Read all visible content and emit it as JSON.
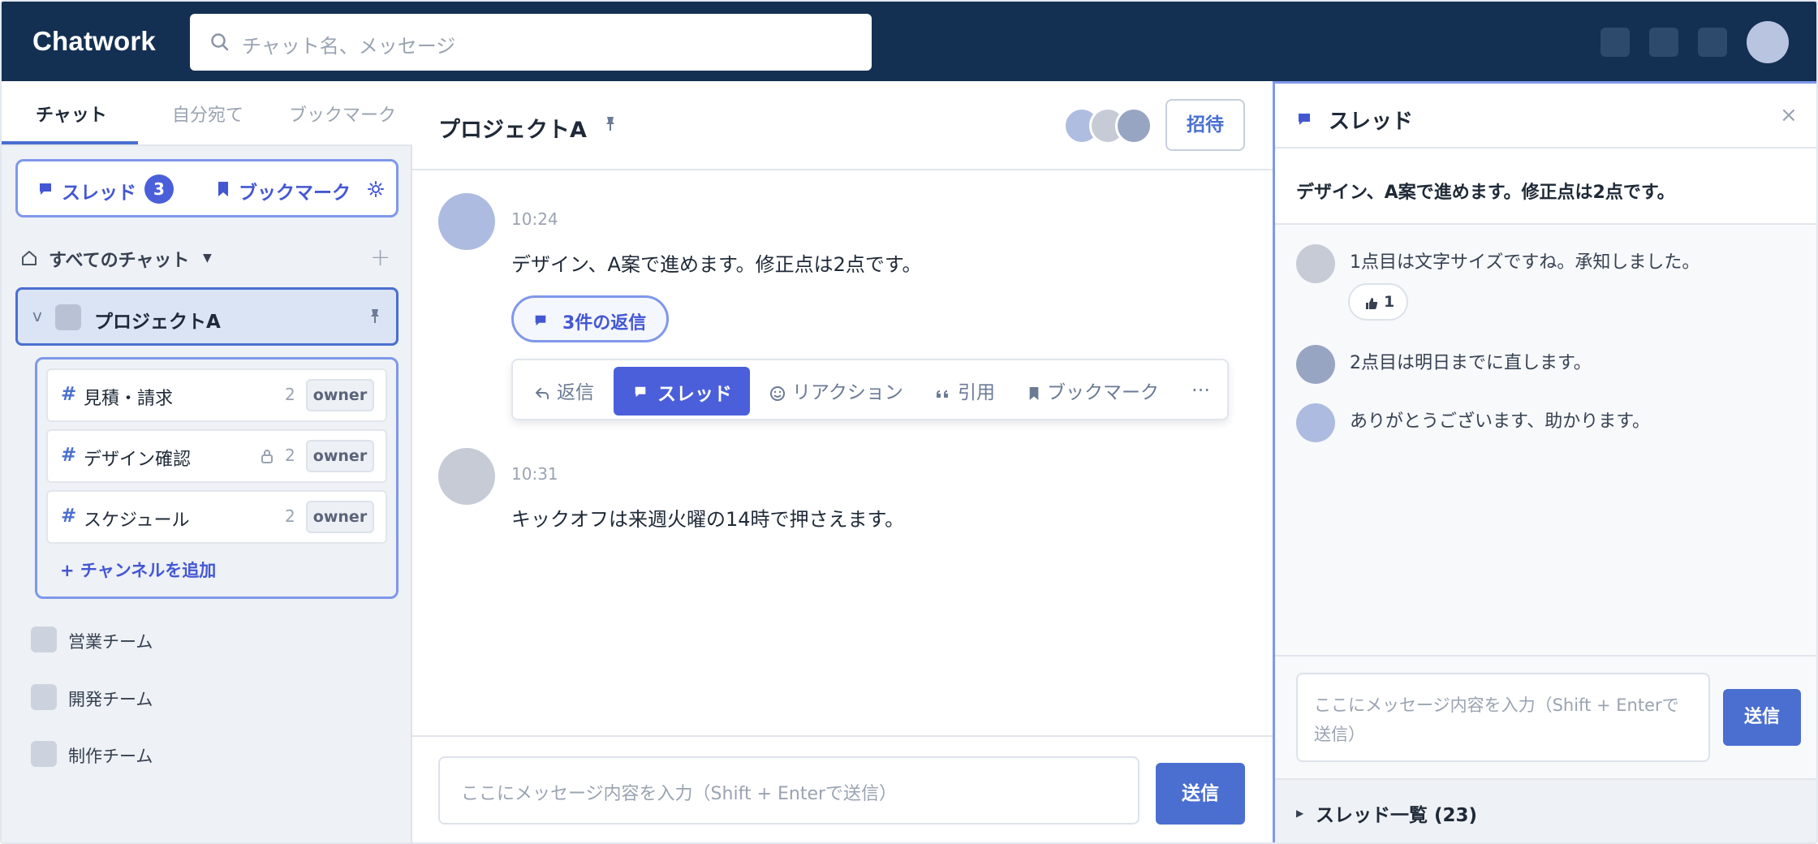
{
  "app": {
    "name": "Chatwork"
  },
  "search": {
    "placeholder": "チャット名、メッセージ"
  },
  "sidebar": {
    "tabs": [
      "チャット",
      "自分宛て",
      "ブックマーク"
    ],
    "thread_button": {
      "label": "スレッド",
      "count": "3"
    },
    "bookmark_button": {
      "label": "ブックマーク"
    },
    "all_chats_label": "すべてのチャット",
    "active_chat": {
      "name": "プロジェクトA",
      "chevron": "v"
    },
    "channels": [
      {
        "hash": "#",
        "name": "見積・請求",
        "count": "2",
        "role": "owner",
        "locked": false
      },
      {
        "hash": "#",
        "name": "デザイン確認",
        "count": "2",
        "role": "owner",
        "locked": true
      },
      {
        "hash": "#",
        "name": "スケジュール",
        "count": "2",
        "role": "owner",
        "locked": false
      }
    ],
    "add_channel_label": "+ チャンネルを追加",
    "teams": [
      "営業チーム",
      "開発チーム",
      "制作チーム"
    ]
  },
  "chat": {
    "title": "プロジェクトA",
    "invite_label": "招待",
    "messages": [
      {
        "time": "10:24",
        "text": "デザイン、A案で進めます。修正点は2点です。",
        "replies_label": "3件の返信"
      },
      {
        "time": "10:31",
        "text": "キックオフは来週火曜の14時で押さえます。"
      }
    ],
    "toolbar": {
      "reply": "返信",
      "thread": "スレッド",
      "reaction": "リアクション",
      "quote": "引用",
      "bookmark": "ブックマーク",
      "more": "…"
    },
    "composer_placeholder": "ここにメッセージ内容を入力（Shift + Enterで送信）",
    "send_label": "送信"
  },
  "thread_panel": {
    "title": "スレッド",
    "close": "×",
    "parent_text": "デザイン、A案で進めます。修正点は2点です。",
    "replies": [
      {
        "text": "1点目は文字サイズですね。承知しました。",
        "reaction_count": "1"
      },
      {
        "text": "2点目は明日までに直します。"
      },
      {
        "text": "ありがとうございます、助かります。"
      }
    ],
    "composer_placeholder": "ここにメッセージ内容を入力（Shift + Enterで送信）",
    "send_label": "送信",
    "list_label": "スレッド一覧 (23)"
  },
  "colors": {
    "header_bg": "#133052",
    "accent": "#4a6fd0",
    "accent_strong": "#4a5fd9",
    "highlight_border": "#7f98ea"
  }
}
